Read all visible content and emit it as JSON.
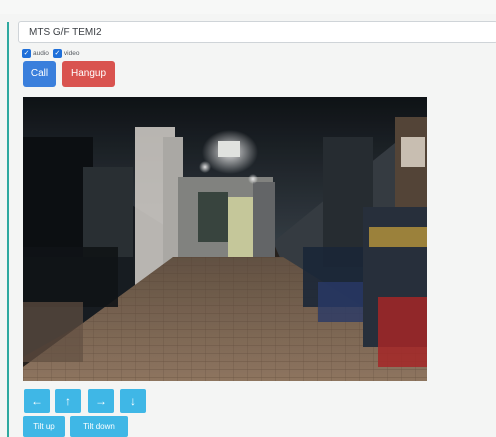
{
  "target": {
    "value": "MTS G/F TEMI2"
  },
  "options": {
    "audio_label": "audio",
    "video_label": "video",
    "audio_checked": true,
    "video_checked": true
  },
  "call_controls": {
    "call_label": "Call",
    "hangup_label": "Hangup"
  },
  "movement": {
    "left_glyph": "←",
    "forward_glyph": "↑",
    "right_glyph": "→",
    "back_glyph": "↓"
  },
  "tilt": {
    "up_label": "Tilt up",
    "down_label": "Tilt down"
  },
  "colors": {
    "accent": "#2fa9a0",
    "call": "#3a7fdc",
    "hangup": "#d9534f",
    "control": "#3fb7e6"
  },
  "icons": {
    "left": "arrow-left-icon",
    "forward": "arrow-up-icon",
    "right": "arrow-right-icon",
    "back": "arrow-down-icon"
  }
}
